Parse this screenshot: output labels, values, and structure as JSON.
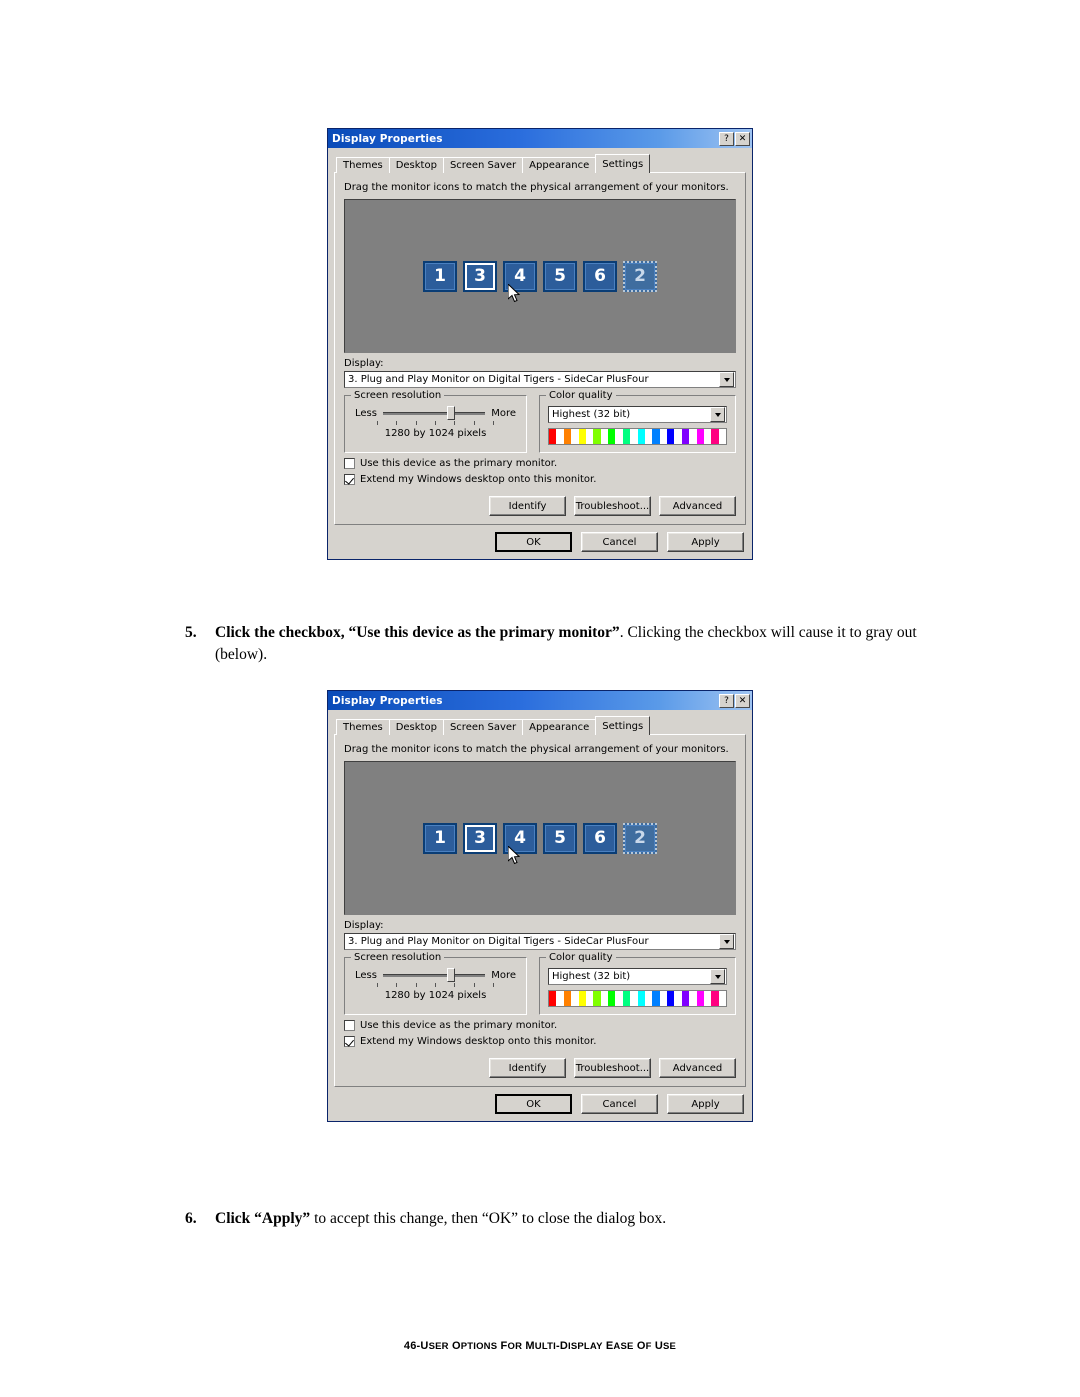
{
  "page": {
    "footer_page": "46-",
    "footer_title": "User Options for Multi-Display Ease of Use",
    "footer_title_caps": "U",
    "steps": [
      {
        "number": "5.",
        "bold_part": "Click the checkbox, “Use this device as the primary monitor”",
        "rest": ". Clicking the checkbox will cause it to gray out (below)."
      },
      {
        "number": "6.",
        "bold_part": "Click “Apply”",
        "rest": " to accept this change, then “OK” to close the dialog box."
      }
    ]
  },
  "dialog": {
    "title": "Display Properties",
    "titlebar_help": "?",
    "titlebar_close": "✕",
    "tabs": [
      {
        "label": "Themes",
        "active": false
      },
      {
        "label": "Desktop",
        "active": false
      },
      {
        "label": "Screen Saver",
        "active": false
      },
      {
        "label": "Appearance",
        "active": false
      },
      {
        "label": "Settings",
        "active": true
      }
    ],
    "hint": "Drag the monitor icons to match the physical arrangement of your monitors.",
    "monitors": [
      {
        "label": "1",
        "state": "normal"
      },
      {
        "label": "3",
        "state": "selected"
      },
      {
        "label": "4",
        "state": "normal"
      },
      {
        "label": "5",
        "state": "normal"
      },
      {
        "label": "6",
        "state": "normal"
      },
      {
        "label": "2",
        "state": "dim"
      }
    ],
    "display_label": "Display:",
    "display_value": "3. Plug and Play Monitor on Digital Tigers - SideCar PlusFour",
    "screen_resolution": {
      "legend": "Screen resolution",
      "less": "Less",
      "more": "More",
      "value": "1280 by 1024 pixels"
    },
    "color_quality": {
      "legend": "Color quality",
      "value": "Highest (32 bit)"
    },
    "checkbox_primary": {
      "label": "Use this device as the primary monitor.",
      "checked": false
    },
    "checkbox_extend": {
      "label": "Extend my Windows desktop onto this monitor.",
      "checked": true
    },
    "buttons": {
      "identify": "Identify",
      "troubleshoot": "Troubleshoot...",
      "advanced": "Advanced",
      "ok": "OK",
      "cancel": "Cancel",
      "apply": "Apply"
    },
    "colors": {
      "titlebar_start": "#0a4bb8",
      "titlebar_end": "#9fc4f2",
      "dialog_face": "#d6d3ce",
      "monitor_blue": "#2c5d9b",
      "preview_gray": "#808080"
    }
  }
}
